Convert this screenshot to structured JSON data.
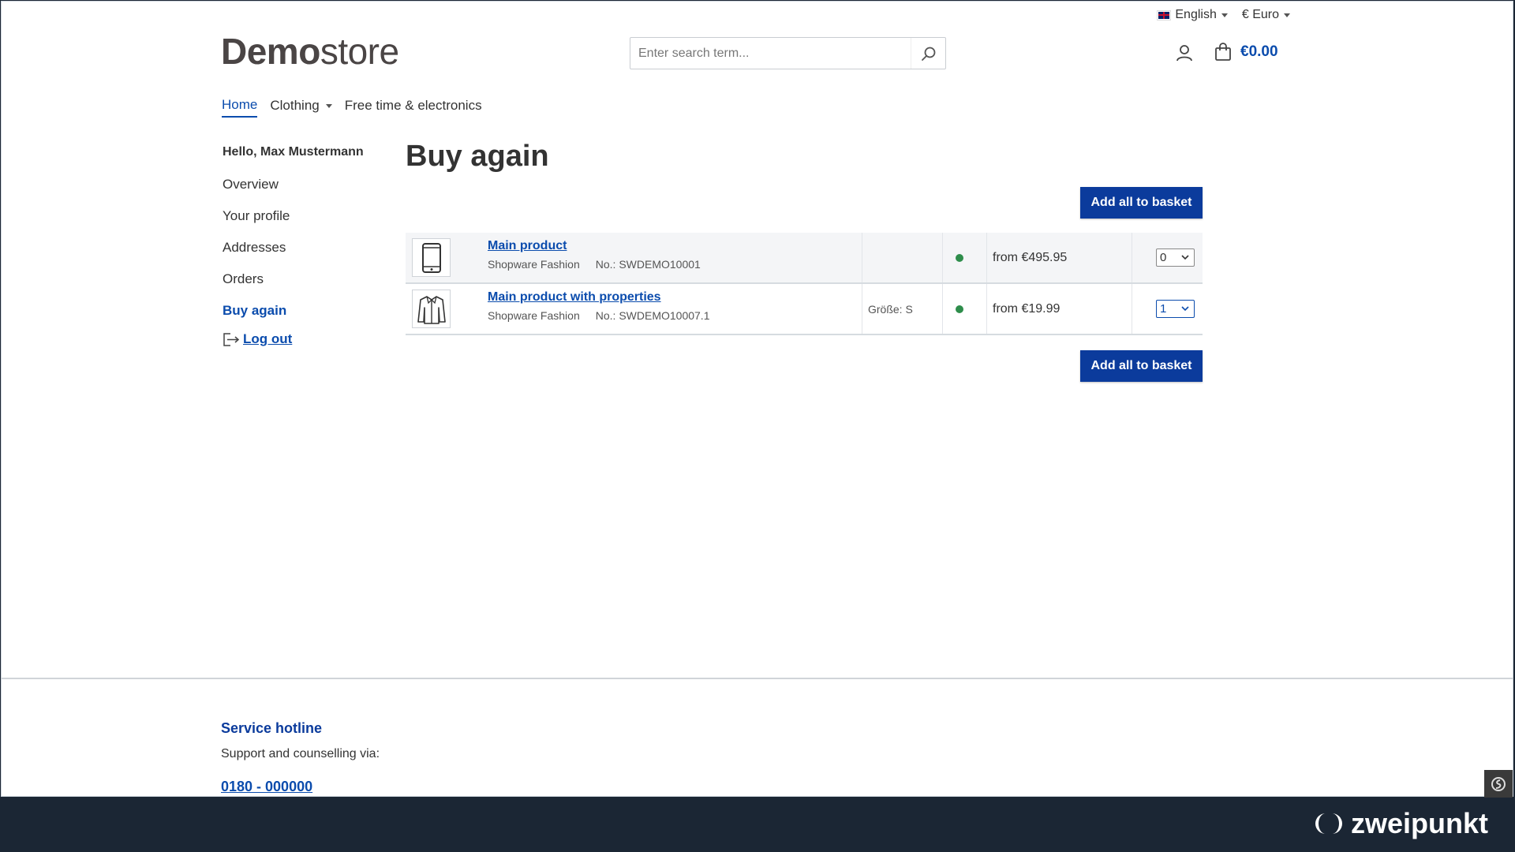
{
  "topbar": {
    "language": "English",
    "currency": "€ Euro"
  },
  "logo": {
    "bold": "Demo",
    "light": "store"
  },
  "search": {
    "placeholder": "Enter search term..."
  },
  "cart": {
    "total": "€0.00"
  },
  "nav": {
    "home": "Home",
    "clothing": "Clothing",
    "freetime": "Free time & electronics"
  },
  "sidebar": {
    "hello": "Hello, Max Mustermann",
    "items": [
      "Overview",
      "Your profile",
      "Addresses",
      "Orders",
      "Buy again"
    ],
    "logout": "Log out"
  },
  "main": {
    "title": "Buy again",
    "add_all_label": "Add all to basket",
    "rows": [
      {
        "name": "Main product",
        "manufacturer": "Shopware Fashion",
        "number": "No.: SWDEMO10001",
        "variant": "",
        "price": "from €495.95",
        "qty": "0",
        "thumb_icon": "smartphone-icon"
      },
      {
        "name": "Main product with properties",
        "manufacturer": "Shopware Fashion",
        "number": "No.: SWDEMO10007.1",
        "variant": "Größe: S",
        "price": "from €19.99",
        "qty": "1",
        "thumb_icon": "jacket-icon"
      }
    ]
  },
  "footer": {
    "hotline_title": "Service hotline",
    "hotline_text": "Support and counselling via:",
    "hotline_phone": "0180 - 000000"
  },
  "brand": {
    "name": "zweipunkt"
  },
  "colors": {
    "primary": "#0b4cad",
    "button": "#0b3b9c",
    "in_stock": "#2e8d4b",
    "brandbar": "#1b2634"
  }
}
